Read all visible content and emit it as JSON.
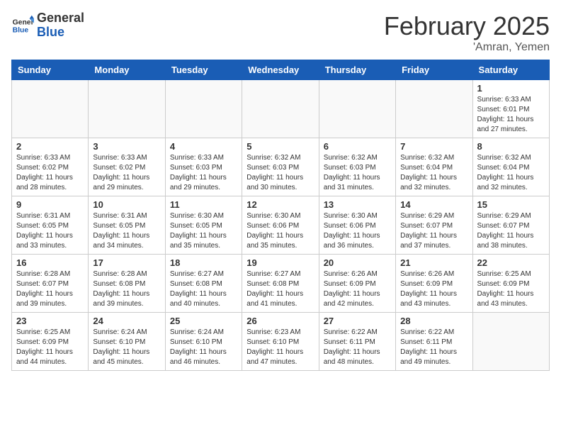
{
  "header": {
    "logo_general": "General",
    "logo_blue": "Blue",
    "month": "February 2025",
    "location": "'Amran, Yemen"
  },
  "weekdays": [
    "Sunday",
    "Monday",
    "Tuesday",
    "Wednesday",
    "Thursday",
    "Friday",
    "Saturday"
  ],
  "weeks": [
    [
      {
        "day": "",
        "info": ""
      },
      {
        "day": "",
        "info": ""
      },
      {
        "day": "",
        "info": ""
      },
      {
        "day": "",
        "info": ""
      },
      {
        "day": "",
        "info": ""
      },
      {
        "day": "",
        "info": ""
      },
      {
        "day": "1",
        "info": "Sunrise: 6:33 AM\nSunset: 6:01 PM\nDaylight: 11 hours and 27 minutes."
      }
    ],
    [
      {
        "day": "2",
        "info": "Sunrise: 6:33 AM\nSunset: 6:02 PM\nDaylight: 11 hours and 28 minutes."
      },
      {
        "day": "3",
        "info": "Sunrise: 6:33 AM\nSunset: 6:02 PM\nDaylight: 11 hours and 29 minutes."
      },
      {
        "day": "4",
        "info": "Sunrise: 6:33 AM\nSunset: 6:03 PM\nDaylight: 11 hours and 29 minutes."
      },
      {
        "day": "5",
        "info": "Sunrise: 6:32 AM\nSunset: 6:03 PM\nDaylight: 11 hours and 30 minutes."
      },
      {
        "day": "6",
        "info": "Sunrise: 6:32 AM\nSunset: 6:03 PM\nDaylight: 11 hours and 31 minutes."
      },
      {
        "day": "7",
        "info": "Sunrise: 6:32 AM\nSunset: 6:04 PM\nDaylight: 11 hours and 32 minutes."
      },
      {
        "day": "8",
        "info": "Sunrise: 6:32 AM\nSunset: 6:04 PM\nDaylight: 11 hours and 32 minutes."
      }
    ],
    [
      {
        "day": "9",
        "info": "Sunrise: 6:31 AM\nSunset: 6:05 PM\nDaylight: 11 hours and 33 minutes."
      },
      {
        "day": "10",
        "info": "Sunrise: 6:31 AM\nSunset: 6:05 PM\nDaylight: 11 hours and 34 minutes."
      },
      {
        "day": "11",
        "info": "Sunrise: 6:30 AM\nSunset: 6:05 PM\nDaylight: 11 hours and 35 minutes."
      },
      {
        "day": "12",
        "info": "Sunrise: 6:30 AM\nSunset: 6:06 PM\nDaylight: 11 hours and 35 minutes."
      },
      {
        "day": "13",
        "info": "Sunrise: 6:30 AM\nSunset: 6:06 PM\nDaylight: 11 hours and 36 minutes."
      },
      {
        "day": "14",
        "info": "Sunrise: 6:29 AM\nSunset: 6:07 PM\nDaylight: 11 hours and 37 minutes."
      },
      {
        "day": "15",
        "info": "Sunrise: 6:29 AM\nSunset: 6:07 PM\nDaylight: 11 hours and 38 minutes."
      }
    ],
    [
      {
        "day": "16",
        "info": "Sunrise: 6:28 AM\nSunset: 6:07 PM\nDaylight: 11 hours and 39 minutes."
      },
      {
        "day": "17",
        "info": "Sunrise: 6:28 AM\nSunset: 6:08 PM\nDaylight: 11 hours and 39 minutes."
      },
      {
        "day": "18",
        "info": "Sunrise: 6:27 AM\nSunset: 6:08 PM\nDaylight: 11 hours and 40 minutes."
      },
      {
        "day": "19",
        "info": "Sunrise: 6:27 AM\nSunset: 6:08 PM\nDaylight: 11 hours and 41 minutes."
      },
      {
        "day": "20",
        "info": "Sunrise: 6:26 AM\nSunset: 6:09 PM\nDaylight: 11 hours and 42 minutes."
      },
      {
        "day": "21",
        "info": "Sunrise: 6:26 AM\nSunset: 6:09 PM\nDaylight: 11 hours and 43 minutes."
      },
      {
        "day": "22",
        "info": "Sunrise: 6:25 AM\nSunset: 6:09 PM\nDaylight: 11 hours and 43 minutes."
      }
    ],
    [
      {
        "day": "23",
        "info": "Sunrise: 6:25 AM\nSunset: 6:09 PM\nDaylight: 11 hours and 44 minutes."
      },
      {
        "day": "24",
        "info": "Sunrise: 6:24 AM\nSunset: 6:10 PM\nDaylight: 11 hours and 45 minutes."
      },
      {
        "day": "25",
        "info": "Sunrise: 6:24 AM\nSunset: 6:10 PM\nDaylight: 11 hours and 46 minutes."
      },
      {
        "day": "26",
        "info": "Sunrise: 6:23 AM\nSunset: 6:10 PM\nDaylight: 11 hours and 47 minutes."
      },
      {
        "day": "27",
        "info": "Sunrise: 6:22 AM\nSunset: 6:11 PM\nDaylight: 11 hours and 48 minutes."
      },
      {
        "day": "28",
        "info": "Sunrise: 6:22 AM\nSunset: 6:11 PM\nDaylight: 11 hours and 49 minutes."
      },
      {
        "day": "",
        "info": ""
      }
    ]
  ]
}
